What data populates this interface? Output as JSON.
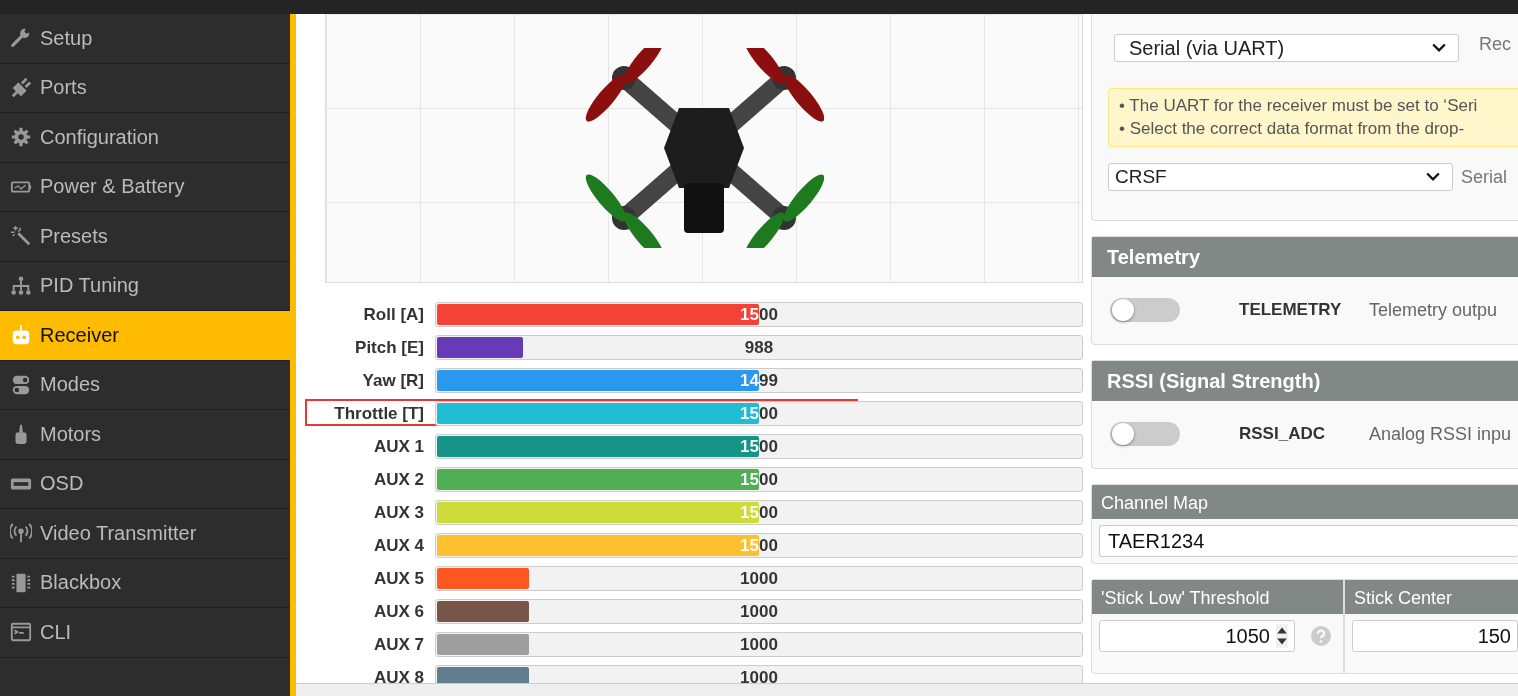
{
  "nav": [
    {
      "label": "Setup",
      "selected": false
    },
    {
      "label": "Ports",
      "selected": false
    },
    {
      "label": "Configuration",
      "selected": false
    },
    {
      "label": "Power & Battery",
      "selected": false
    },
    {
      "label": "Presets",
      "selected": false
    },
    {
      "label": "PID Tuning",
      "selected": false
    },
    {
      "label": "Receiver",
      "selected": true
    },
    {
      "label": "Modes",
      "selected": false
    },
    {
      "label": "Motors",
      "selected": false
    },
    {
      "label": "OSD",
      "selected": false
    },
    {
      "label": "Video Transmitter",
      "selected": false
    },
    {
      "label": "Blackbox",
      "selected": false
    },
    {
      "label": "CLI",
      "selected": false
    }
  ],
  "channels": [
    {
      "name": "Roll [A]",
      "value": "1500",
      "level": 0.5,
      "color": "#f44336",
      "highlighted": false
    },
    {
      "name": "Pitch [E]",
      "value": "988",
      "level": 0.134,
      "color": "#673ab7",
      "highlighted": false
    },
    {
      "name": "Yaw [R]",
      "value": "1499",
      "level": 0.5,
      "color": "#2b98f0",
      "highlighted": false
    },
    {
      "name": "Throttle [T]",
      "value": "1500",
      "level": 0.5,
      "color": "#1fbcd2",
      "highlighted": true
    },
    {
      "name": "AUX 1",
      "value": "1500",
      "level": 0.5,
      "color": "#159588",
      "highlighted": false
    },
    {
      "name": "AUX 2",
      "value": "1500",
      "level": 0.5,
      "color": "#50ae55",
      "highlighted": false
    },
    {
      "name": "AUX 3",
      "value": "1500",
      "level": 0.5,
      "color": "#cddc39",
      "highlighted": false
    },
    {
      "name": "AUX 4",
      "value": "1500",
      "level": 0.5,
      "color": "#fdc02f",
      "highlighted": false
    },
    {
      "name": "AUX 5",
      "value": "1000",
      "level": 0.143,
      "color": "#fe5722",
      "highlighted": false
    },
    {
      "name": "AUX 6",
      "value": "1000",
      "level": 0.143,
      "color": "#795548",
      "highlighted": false
    },
    {
      "name": "AUX 7",
      "value": "1000",
      "level": 0.143,
      "color": "#9e9e9e",
      "highlighted": false
    },
    {
      "name": "AUX 8",
      "value": "1000",
      "level": 0.143,
      "color": "#607d8b",
      "highlighted": false
    }
  ],
  "receiver": {
    "mode_select": "Serial (via UART)",
    "mode_label": "Rec",
    "notes": [
      "• The UART for the receiver must be set to ‘Seri",
      "• Select the correct data format from the drop-"
    ],
    "provider_select": "CRSF",
    "provider_label": "Serial"
  },
  "telemetry": {
    "title": "Telemetry",
    "on": false,
    "name": "TELEMETRY",
    "description": "Telemetry outpu"
  },
  "rssi": {
    "title": "RSSI (Signal Strength)",
    "on": false,
    "name": "RSSI_ADC",
    "description": "Analog RSSI inpu"
  },
  "channel_map": {
    "title": "Channel Map",
    "value": "TAER1234"
  },
  "sticks": [
    {
      "title": "'Stick Low' Threshold",
      "value": "1050"
    },
    {
      "title": "Stick Center",
      "value": "150"
    }
  ]
}
